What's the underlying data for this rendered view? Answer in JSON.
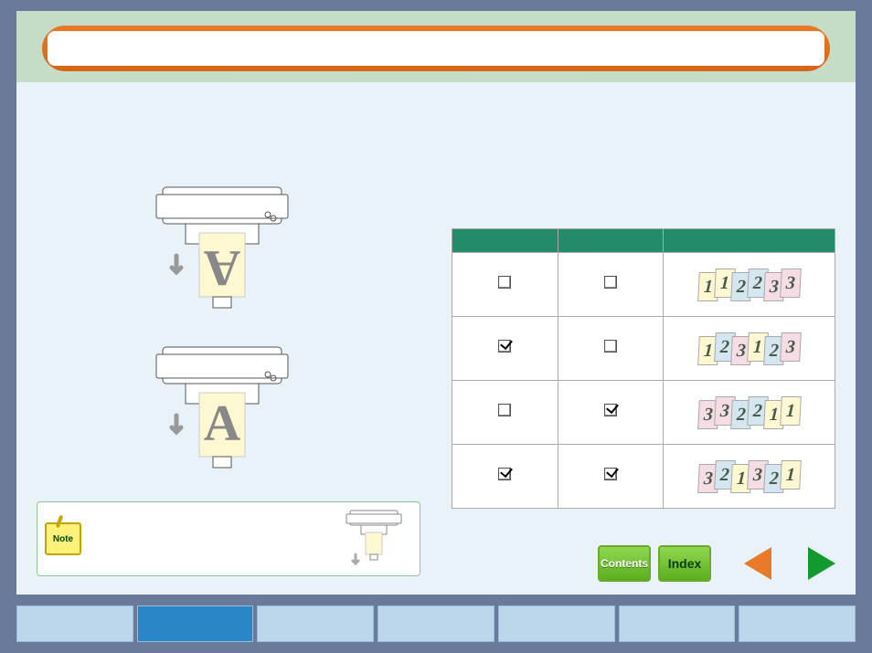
{
  "title_bar": {
    "text": ""
  },
  "note": {
    "label": "Note"
  },
  "table": {
    "headers": [
      "",
      "",
      ""
    ],
    "rows": [
      {
        "col1_checked": false,
        "col2_checked": false,
        "sheets": [
          "1",
          "1",
          "2",
          "2",
          "3",
          "3"
        ],
        "colors": [
          "c1",
          "c1",
          "c2",
          "c2",
          "c3",
          "c3"
        ]
      },
      {
        "col1_checked": true,
        "col2_checked": false,
        "sheets": [
          "1",
          "2",
          "3",
          "1",
          "2",
          "3"
        ],
        "colors": [
          "c1",
          "c2",
          "c3",
          "c1",
          "c2",
          "c3"
        ]
      },
      {
        "col1_checked": false,
        "col2_checked": true,
        "sheets": [
          "3",
          "3",
          "2",
          "2",
          "1",
          "1"
        ],
        "colors": [
          "c3",
          "c3",
          "c2",
          "c2",
          "c1",
          "c1"
        ]
      },
      {
        "col1_checked": true,
        "col2_checked": true,
        "sheets": [
          "3",
          "2",
          "1",
          "3",
          "2",
          "1"
        ],
        "colors": [
          "c3",
          "c2",
          "c1",
          "c3",
          "c2",
          "c1"
        ]
      }
    ]
  },
  "nav": {
    "contents": "Contents",
    "index": "Index"
  },
  "tabs": {
    "count": 7,
    "active_index": 1
  },
  "printer": {
    "label_up": "A",
    "label_down": "A"
  }
}
